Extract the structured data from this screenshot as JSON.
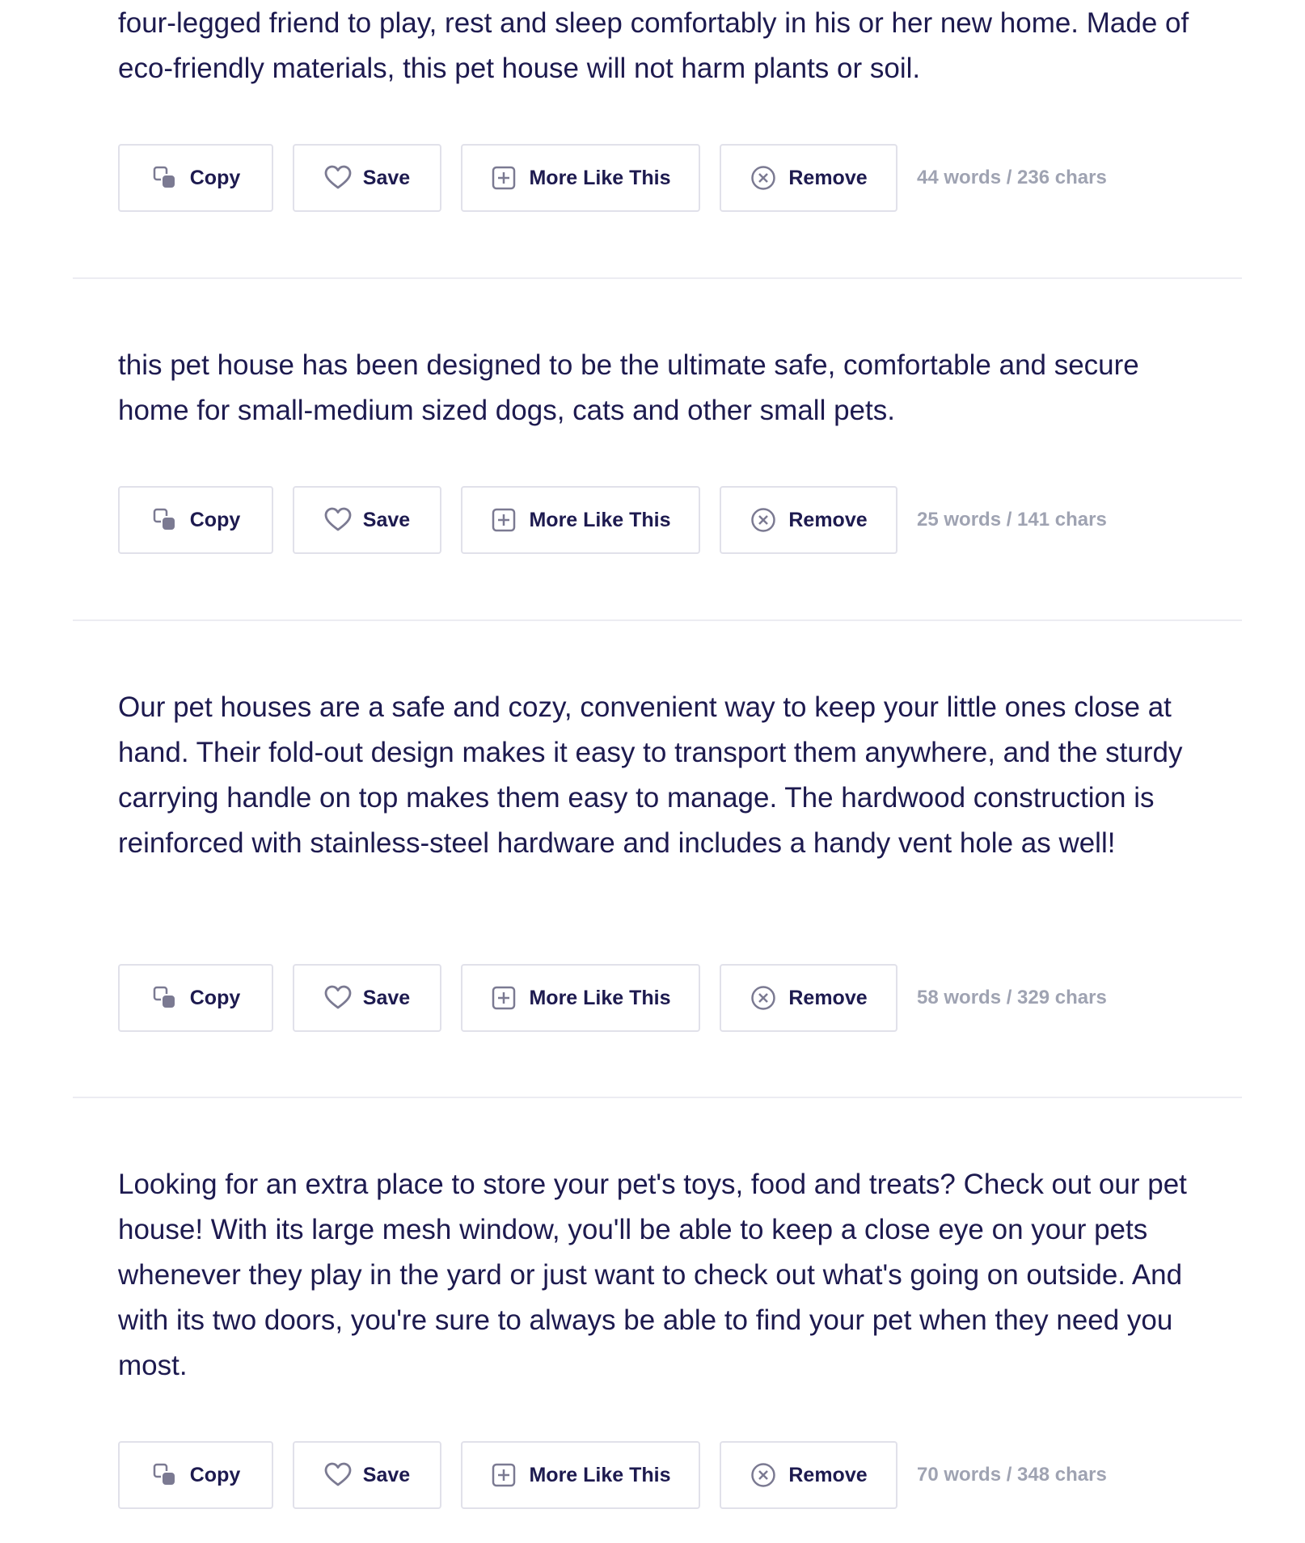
{
  "buttons": {
    "copy": "Copy",
    "save": "Save",
    "more": "More Like This",
    "remove": "Remove"
  },
  "icons": {
    "copy": "copy-icon",
    "save": "heart-icon",
    "more": "plus-square-icon",
    "remove": "close-circle-icon"
  },
  "colors": {
    "text": "#1d1a4f",
    "muted": "#9fa3b2",
    "border": "#e1e1ea",
    "icon": "#7b7a92"
  },
  "results": [
    {
      "text": "four-legged friend to play, rest and sleep comfortably in his or her new home. Made of eco-friendly materials, this pet house will not harm plants or soil.",
      "count": "44 words / 236 chars"
    },
    {
      "text": "this pet house has been designed to be the ultimate safe, comfortable and secure home for small-medium sized dogs, cats and other small pets.",
      "count": "25 words / 141 chars"
    },
    {
      "text": "Our pet houses are a safe and cozy, convenient way to keep your little ones close at hand. Their fold-out design makes it easy to transport them anywhere, and the sturdy carrying handle on top makes them easy to manage. The hardwood construction is reinforced with stainless-steel hardware and includes a handy vent hole as well!",
      "count": "58 words / 329 chars"
    },
    {
      "text": "Looking for an extra place to store your pet's toys, food and treats? Check out our pet house! With its large mesh window, you'll be able to keep a close eye on your pets whenever they play in the yard or just want to check out what's going on outside. And with its two doors, you're sure to always be able to find your pet when they need you most.",
      "count": "70 words / 348 chars"
    }
  ]
}
